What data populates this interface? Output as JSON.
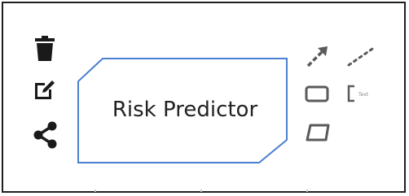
{
  "node": {
    "label": "Risk Predictor",
    "stroke_color": "#4a7fd1",
    "fill_color": "#ffffff"
  },
  "context_pad": {
    "left_actions": [
      {
        "name": "delete",
        "icon": "trash-icon"
      },
      {
        "name": "edit-label",
        "icon": "edit-icon"
      },
      {
        "name": "connect",
        "icon": "share-icon"
      }
    ],
    "right_actions": [
      {
        "name": "append-connection",
        "icon": "arrow-connection-icon"
      },
      {
        "name": "append-association",
        "icon": "dotted-association-icon"
      },
      {
        "name": "append-task",
        "icon": "rectangle-icon"
      },
      {
        "name": "append-text-annotation",
        "icon": "text-annotation-icon"
      },
      {
        "name": "append-data-object",
        "icon": "parallelogram-icon"
      }
    ],
    "annotation_label": "Text"
  },
  "colors": {
    "icon_dark": "#1a1a1a",
    "icon_gray": "#5a5a5a",
    "frame_border": "#1f1f1f"
  }
}
